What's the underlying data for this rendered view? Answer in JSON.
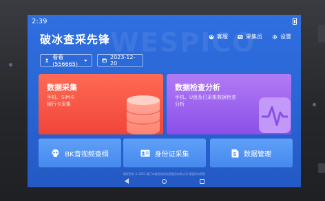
{
  "status": {
    "time": "2:39"
  },
  "watermark": "WESPICO",
  "app": {
    "title": "破冰查采先锋"
  },
  "header": {
    "actions": [
      {
        "label": "客服",
        "icon": "headset-icon"
      },
      {
        "label": "采集员",
        "icon": "id-card-icon"
      },
      {
        "label": "设置",
        "icon": "gear-icon"
      }
    ]
  },
  "filters": {
    "user": "看看(556665)",
    "date": "2023-12-20"
  },
  "cards": {
    "collect": {
      "title": "数据采集",
      "subtitle": "手机、SIM卡\n银行卡采集",
      "color": "#f0453a"
    },
    "analysis": {
      "title": "数据检查分析",
      "subtitle": "手机、U盘及已采集数据检查分析",
      "color": "#8a4fe8"
    }
  },
  "tiles": [
    {
      "label": "BK音视频查缉",
      "icon": "skull-icon"
    },
    {
      "label": "身份证采集",
      "icon": "id-card-icon"
    },
    {
      "label": "数据管理",
      "icon": "document-icon"
    }
  ],
  "footer": "版权所有 © 2023 厦门市美亚柏科信息股份有限公司 保留所有权利",
  "colors": {
    "screen": "#2a66d6",
    "tile": "#4f92f2"
  }
}
